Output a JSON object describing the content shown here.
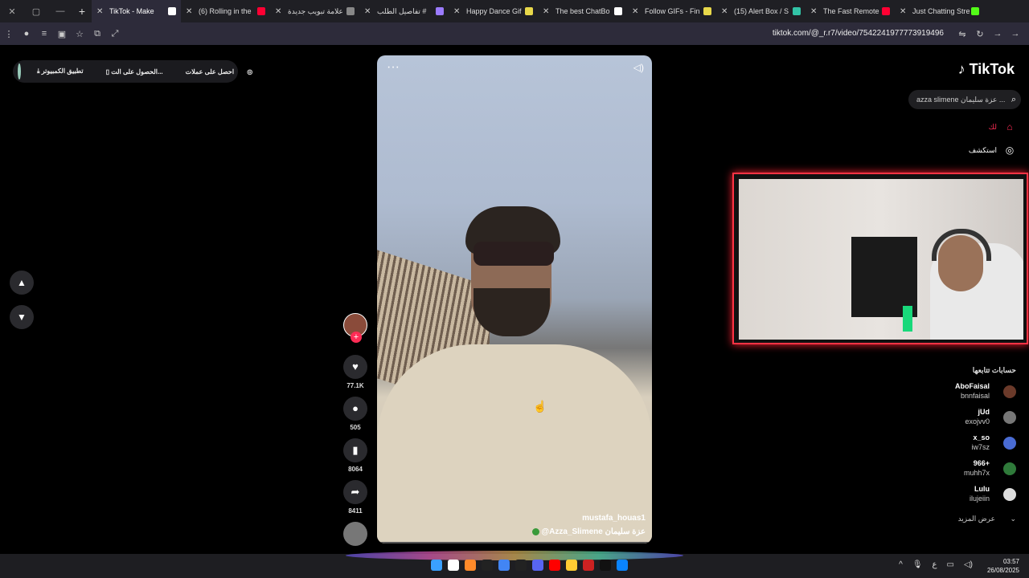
{
  "browser": {
    "tabs": [
      {
        "title": "TikTok - Make",
        "icon": "tiktok-icon",
        "color": "#ffffff",
        "active": true
      },
      {
        "title": "(6) Rolling in the",
        "icon": "youtube-icon",
        "color": "#ff0033"
      },
      {
        "title": "علامة تبويب جديدة",
        "icon": "chrome-icon",
        "color": "#888888"
      },
      {
        "title": "تفاصيل الطلب #",
        "icon": "store-icon",
        "color": "#9b7bff"
      },
      {
        "title": "Happy Dance Gif",
        "icon": "file-icon",
        "color": "#e8d84a"
      },
      {
        "title": "The best ChatBo",
        "icon": "diamond-icon",
        "color": "#ffffff"
      },
      {
        "title": "Follow GIFs - Fin",
        "icon": "file-icon",
        "color": "#e8d84a"
      },
      {
        "title": "(15) Alert Box / S",
        "icon": "streamlabs-icon",
        "color": "#32c3a6"
      },
      {
        "title": "The Fast Remote",
        "icon": "youtube-icon",
        "color": "#ff0033"
      },
      {
        "title": "Just Chatting Stre",
        "icon": "kick-icon",
        "color": "#53fc18"
      }
    ],
    "url": "tiktok.com/@_r.r7/video/7542241977773919496"
  },
  "promo": {
    "get_coins": "احصل على عملات",
    "get_app": "الحصول على الت...",
    "pc_app": "تطبيق الكمبيوتر"
  },
  "video": {
    "username": "mustafa_houas1",
    "nickname": "@Azza_Slimene عزة سليمان"
  },
  "actions": {
    "likes": "77.1K",
    "comments": "505",
    "saves": "8064",
    "shares": "8411"
  },
  "sidebar": {
    "logo": "TikTok",
    "search_placeholder": "azza slimene عزة سليمان ...",
    "nav": [
      {
        "label": "لك",
        "icon": "home-icon"
      },
      {
        "label": "استكشف",
        "icon": "compass-icon"
      }
    ],
    "following_title": "حسابات تتابعها",
    "following": [
      {
        "name": "AboFaisal",
        "handle": "bnnfaisal",
        "color": "#6b3a2a"
      },
      {
        "name": "jUd",
        "handle": "exojvv0",
        "color": "#777777"
      },
      {
        "name": "x_so",
        "handle": "iw7sz",
        "color": "#4a6cd4"
      },
      {
        "name": "966+",
        "handle": "muhh7x",
        "color": "#2f7a3a"
      },
      {
        "name": "Lulu",
        "handle": "ilujeiin",
        "color": "#dddddd"
      }
    ],
    "see_more": "عرض المزيد"
  },
  "taskbar": {
    "lang": "ع",
    "time": "03:57",
    "date": "26/08/2025",
    "colors": [
      "#3aa0ff",
      "#ffffff",
      "#ff8a2a",
      "#222222",
      "#4285f4",
      "#222222",
      "#5865f2",
      "#ff0000",
      "#ffcc33",
      "#cc2222",
      "#111111",
      "#0a84ff"
    ]
  }
}
